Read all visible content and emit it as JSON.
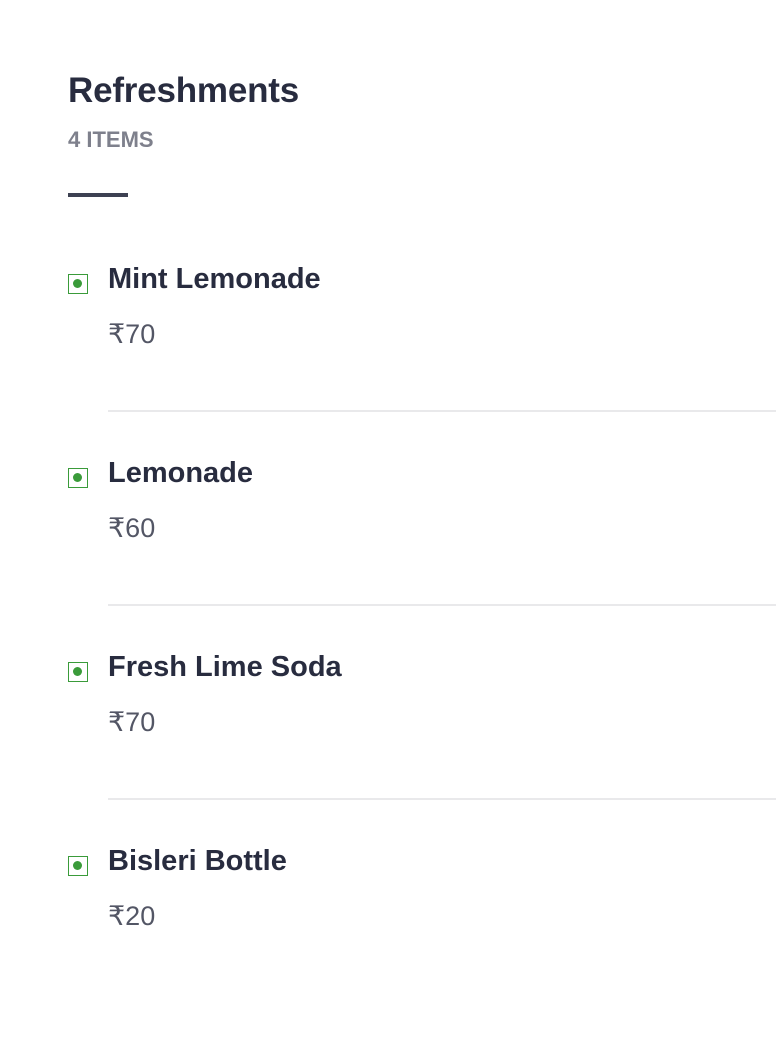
{
  "section": {
    "title": "Refreshments",
    "item_count": "4 ITEMS"
  },
  "items": [
    {
      "name": "Mint Lemonade",
      "price": "₹70",
      "veg": true
    },
    {
      "name": "Lemonade",
      "price": "₹60",
      "veg": true
    },
    {
      "name": "Fresh Lime Soda",
      "price": "₹70",
      "veg": true
    },
    {
      "name": "Bisleri Bottle",
      "price": "₹20",
      "veg": true
    }
  ],
  "colors": {
    "veg_indicator": "#3a9b3a",
    "title_text": "#282c3f",
    "secondary_text": "#7e808c",
    "price_text": "#535665",
    "divider": "#e9e9eb"
  },
  "icons": {
    "veg_indicator": "veg-indicator-icon"
  }
}
